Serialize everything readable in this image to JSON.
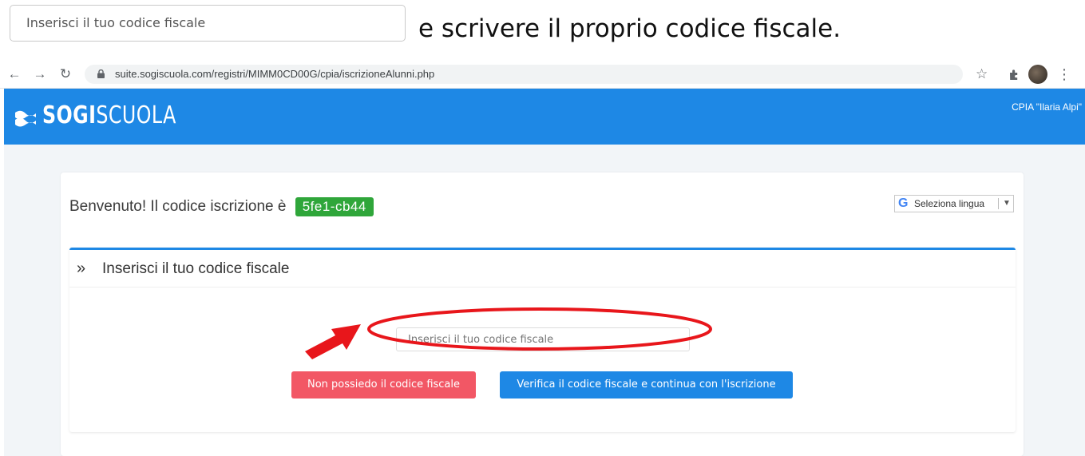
{
  "tutorial": {
    "input_placeholder": "Inserisci il tuo codice fiscale",
    "caption": "e scrivere il proprio codice fiscale."
  },
  "browser": {
    "url": "suite.sogiscuola.com/registri/MIMM0CD00G/cpia/iscrizioneAlunni.php",
    "icons": [
      "back-icon",
      "forward-icon",
      "reload-icon",
      "lock-icon",
      "star-icon",
      "extensions-icon",
      "profile-avatar",
      "menu-icon"
    ]
  },
  "header": {
    "logo_bold": "SOGI",
    "logo_light": "SCUOLA",
    "school": "CPIA \"Ilaria Alpi\"",
    "color": "#1e88e5"
  },
  "welcome": {
    "text": "Benvenuto! Il codice iscrizione è",
    "code": "5fe1-cb44",
    "code_color": "#2fa63a"
  },
  "language": {
    "label": "Seleziona lingua",
    "icon": "google-g-icon"
  },
  "panel": {
    "title": "Inserisci il tuo codice fiscale",
    "input_placeholder": "Inserisci il tuo codice fiscale",
    "buttons": {
      "no_cf": "Non possiedo il codice fiscale",
      "verify": "Verifica il codice fiscale e continua con l'iscrizione"
    },
    "colors": {
      "no_cf": "#f25765",
      "verify": "#1e88e5"
    }
  },
  "annotation": {
    "color": "#e8161b"
  }
}
